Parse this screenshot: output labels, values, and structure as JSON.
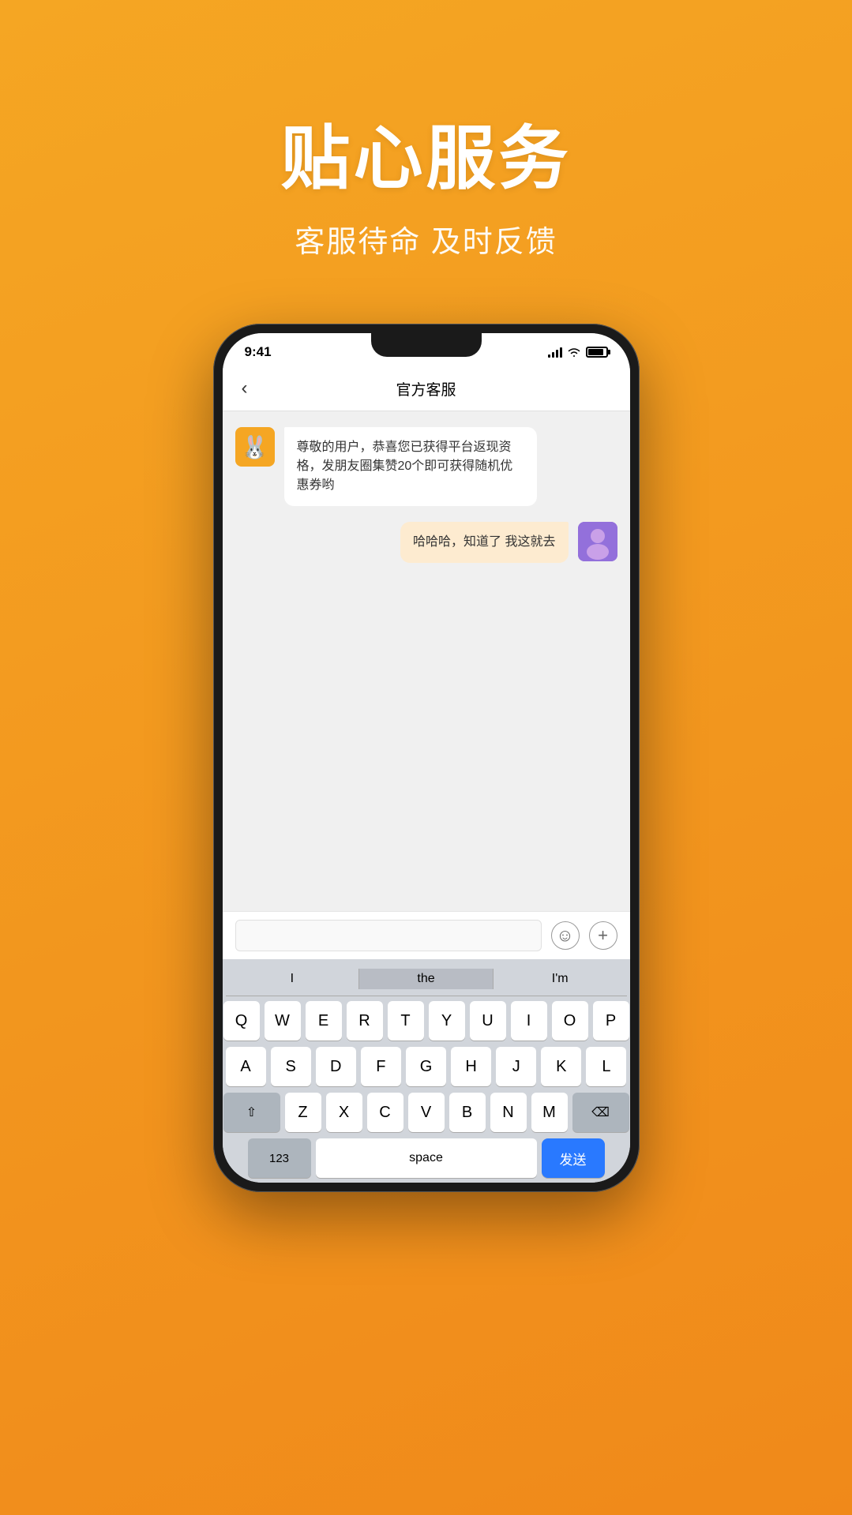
{
  "hero": {
    "title": "贴心服务",
    "subtitle": "客服待命 及时反馈"
  },
  "phone": {
    "status_bar": {
      "time": "9:41",
      "signal_bars": [
        4,
        7,
        10,
        13
      ],
      "battery_level": "80%"
    },
    "nav": {
      "back_icon": "‹",
      "title": "官方客服"
    },
    "messages": [
      {
        "id": "msg1",
        "side": "left",
        "avatar_type": "rabbit",
        "text": "尊敬的用户，恭喜您已获得平台返现资格，发朋友圈集赞20个即可获得随机优惠券哟"
      },
      {
        "id": "msg2",
        "side": "right",
        "avatar_type": "user",
        "text": "哈哈哈，知道了 我这就去"
      }
    ],
    "input_bar": {
      "placeholder": "",
      "emoji_icon": "☺",
      "plus_icon": "+"
    },
    "keyboard": {
      "predictive": [
        "I",
        "the",
        "I'm"
      ],
      "rows": [
        [
          "Q",
          "W",
          "E",
          "R",
          "T",
          "Y",
          "U",
          "I",
          "O",
          "P"
        ],
        [
          "A",
          "S",
          "D",
          "F",
          "G",
          "H",
          "J",
          "K",
          "L"
        ],
        [
          "⇧",
          "Z",
          "X",
          "C",
          "V",
          "B",
          "N",
          "M",
          "⌫"
        ]
      ],
      "bottom": {
        "num_label": "123",
        "space_label": "space",
        "send_label": "发送"
      }
    }
  }
}
